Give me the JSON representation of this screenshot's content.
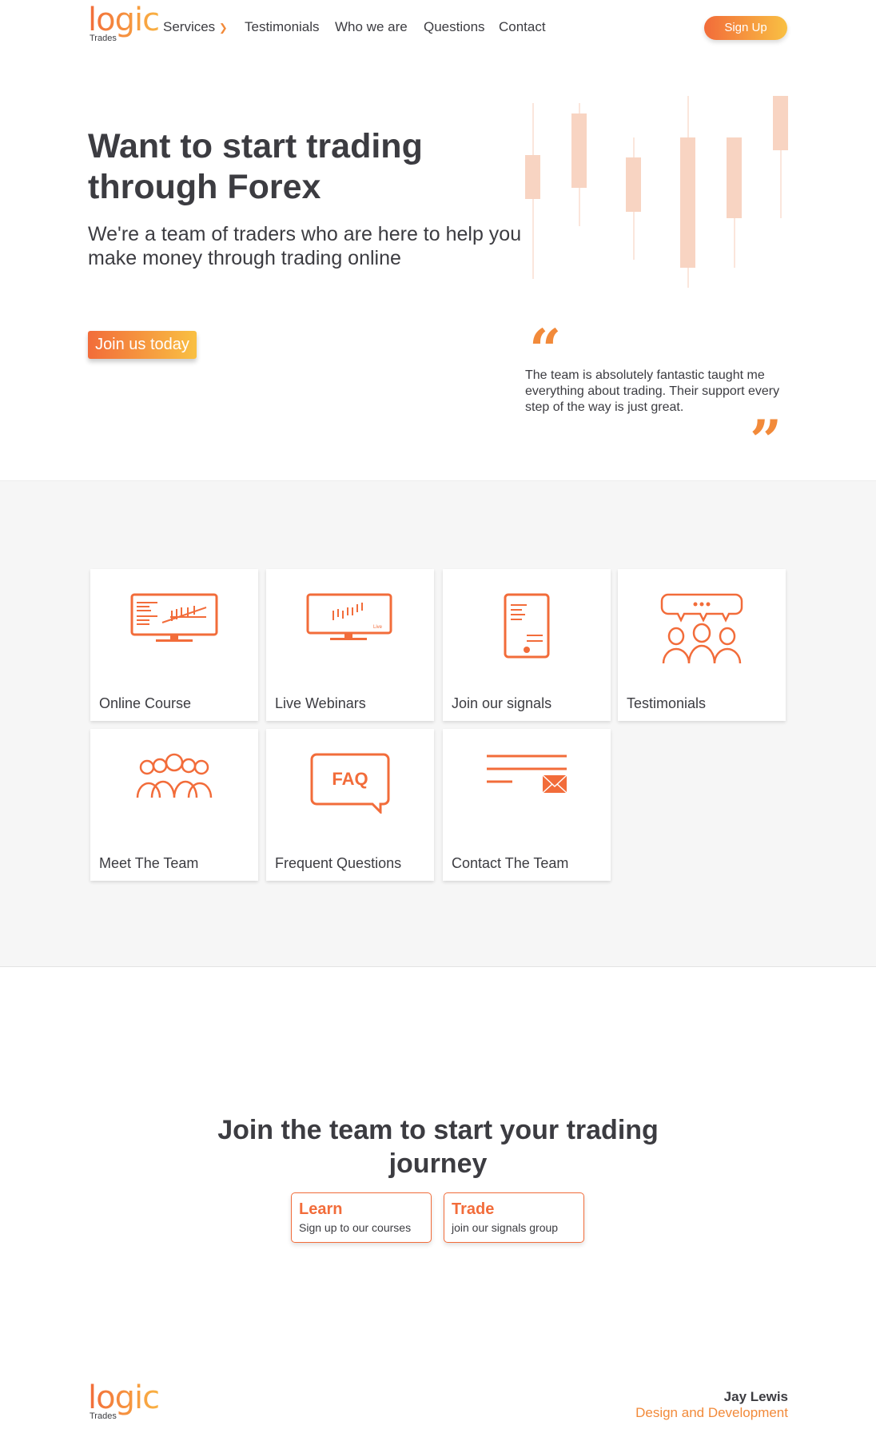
{
  "brand": {
    "logo_word": "logic",
    "logo_sub": "Trades"
  },
  "nav": {
    "services": "Services",
    "testimonials": "Testimonials",
    "who": "Who we are",
    "questions": "Questions",
    "contact": "Contact",
    "signup": "Sign Up"
  },
  "hero": {
    "title": "Want to start trading through Forex",
    "subtitle": "We're a team of traders who are here to help you make money through trading online",
    "cta": "Join us today"
  },
  "quote": {
    "open": "“",
    "text": "The team is absolutely fantastic taught me everything about trading. Their support every step of the way is just great.",
    "close": "”"
  },
  "cards": [
    {
      "label": "Online Course"
    },
    {
      "label": "Live Webinars",
      "badge": "Live"
    },
    {
      "label": "Join our signals"
    },
    {
      "label": "Testimonials"
    },
    {
      "label": "Meet The Team"
    },
    {
      "label": "Frequent Questions",
      "badge": "FAQ"
    },
    {
      "label": "Contact The Team"
    }
  ],
  "join": {
    "heading": "Join the team to start your trading journey",
    "learn_title": "Learn",
    "learn_desc": "Sign up to our courses",
    "trade_title": "Trade",
    "trade_desc": "join our signals group"
  },
  "footer": {
    "name": "Jay Lewis",
    "role": "Design and Development"
  },
  "colors": {
    "accent": "#f26c3a",
    "accent2": "#f9c043",
    "text": "#3c3c41"
  }
}
